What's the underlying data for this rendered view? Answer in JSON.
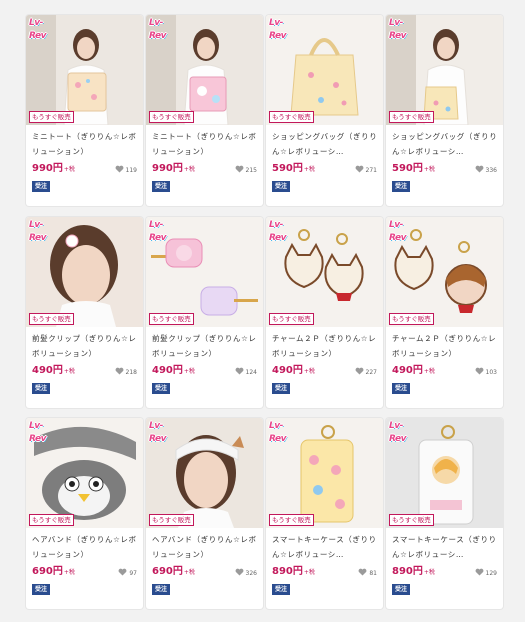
{
  "theme": {
    "accent": "#c2185b",
    "order_badge": "#2a4c8f",
    "logo_pink": "#e8458a",
    "logo_blue": "#3fb6f0"
  },
  "logo_text": "Lv-Rev",
  "badge_label": "もうすぐ販売",
  "order_label": "受注",
  "tax_label": "+税",
  "heart_icon": "heart-icon",
  "products": [
    {
      "name": "ミニトート（ぎりりん☆レボリューション）",
      "price": "990円",
      "likes": "119",
      "image": "woman-with-tote"
    },
    {
      "name": "ミニトート（ぎりりん☆レボリューション）",
      "price": "990円",
      "likes": "215",
      "image": "woman-with-pink-tote"
    },
    {
      "name": "ショッピングバッグ（ぎりりん☆レボリューシ…",
      "price": "590円",
      "likes": "271",
      "image": "folded-shopping-bag"
    },
    {
      "name": "ショッピングバッグ（ぎりりん☆レボリューシ…",
      "price": "590円",
      "likes": "336",
      "image": "woman-with-shopping-bag"
    },
    {
      "name": "前髪クリップ（ぎりりん☆レボリューション）",
      "price": "490円",
      "likes": "218",
      "image": "woman-with-hair-clip"
    },
    {
      "name": "前髪クリップ（ぎりりん☆レボリューション）",
      "price": "490円",
      "likes": "124",
      "image": "pair-of-hair-clips"
    },
    {
      "name": "チャーム２Ｐ（ぎりりん☆レボリューション）",
      "price": "490円",
      "likes": "227",
      "image": "cat-charms"
    },
    {
      "name": "チャーム２Ｐ（ぎりりん☆レボリューション）",
      "price": "490円",
      "likes": "103",
      "image": "cat-and-girl-charms"
    },
    {
      "name": "ヘアバンド（ぎりりん☆レボリューション）",
      "price": "690円",
      "likes": "97",
      "image": "penguin-headband"
    },
    {
      "name": "ヘアバンド（ぎりりん☆レボリューション）",
      "price": "690円",
      "likes": "326",
      "image": "woman-with-headband"
    },
    {
      "name": "スマートキーケース（ぎりりん☆レボリューシ…",
      "price": "890円",
      "likes": "81",
      "image": "yellow-key-case"
    },
    {
      "name": "スマートキーケース（ぎりりん☆レボリューシ…",
      "price": "890円",
      "likes": "129",
      "image": "clear-key-case"
    }
  ]
}
